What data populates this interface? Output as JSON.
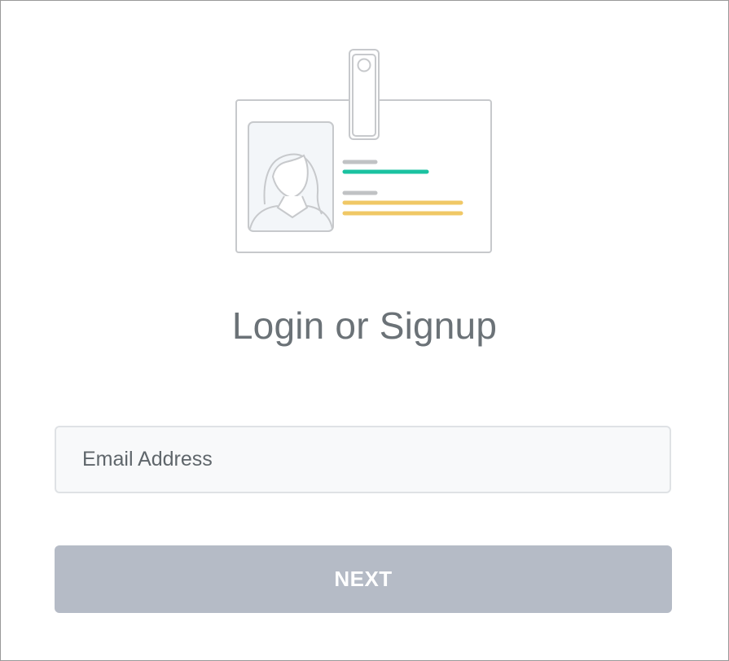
{
  "title": "Login or Signup",
  "email_field": {
    "placeholder": "Email Address",
    "value": ""
  },
  "next_button": {
    "label": "NEXT"
  },
  "colors": {
    "badge_outline": "#c7c9cc",
    "badge_photo_bg": "#f3f6f9",
    "badge_line_gray": "#c0c2c4",
    "badge_line_teal": "#1bc2a1",
    "badge_line_yellow": "#f0c866",
    "title_text": "#6b7277",
    "input_bg": "#f8f9fa",
    "input_border": "#dfe2e5",
    "button_bg": "#b5bbc6",
    "button_text": "#ffffff"
  },
  "icons": {
    "illustration": "id-badge-icon"
  }
}
